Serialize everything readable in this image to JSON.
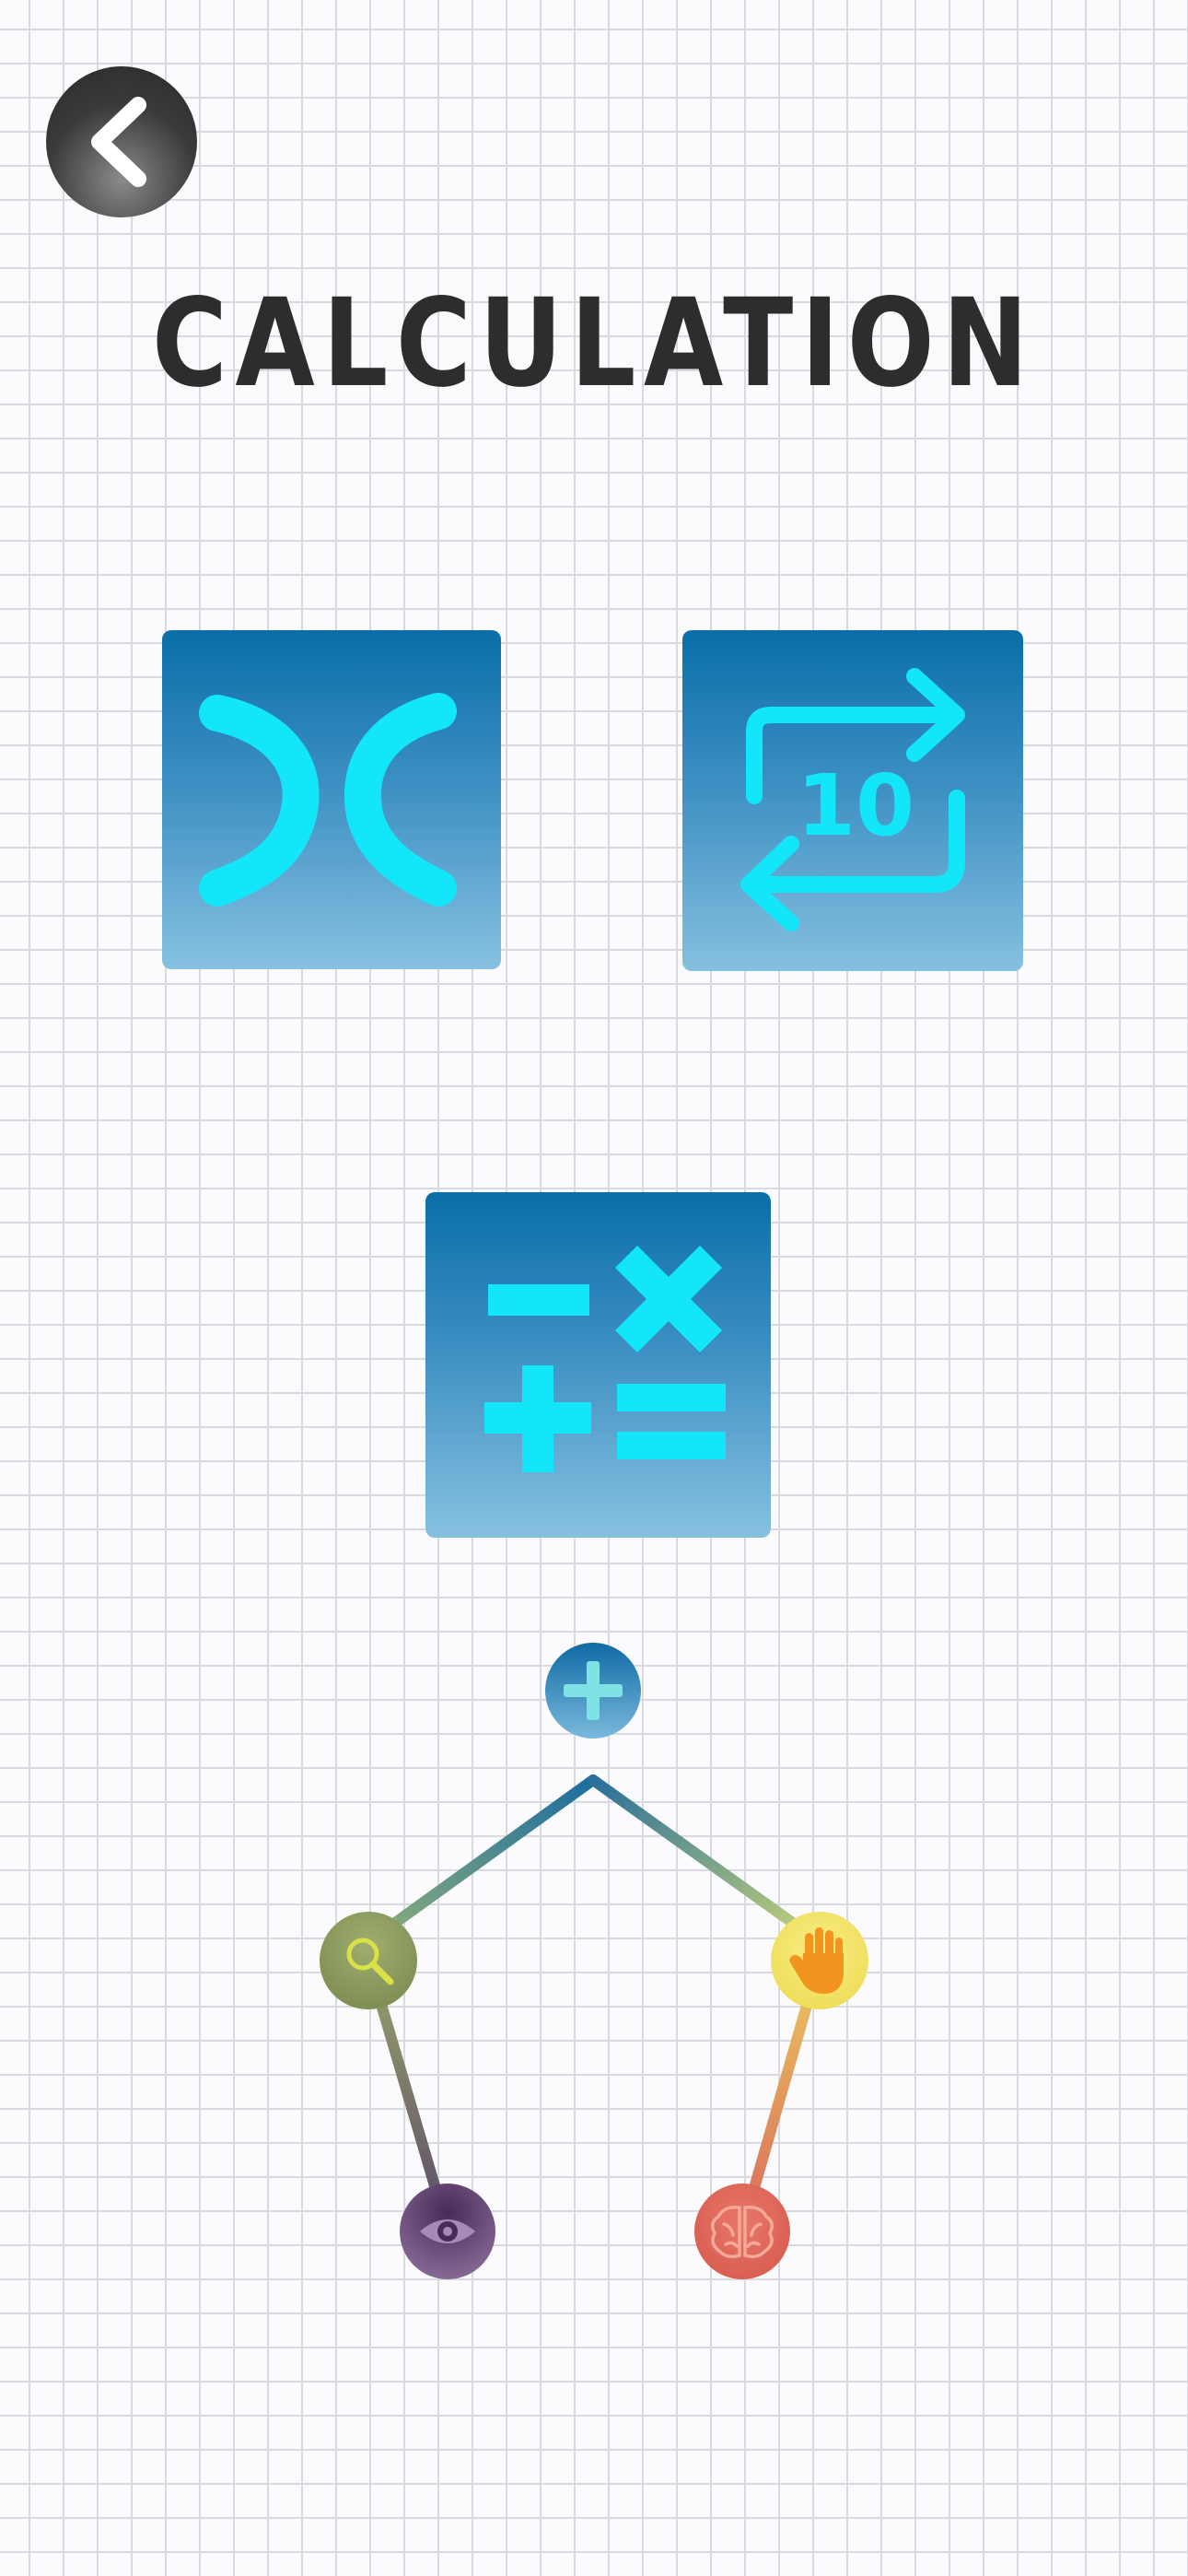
{
  "screen": {
    "title": "CALCULATION"
  },
  "header": {
    "back_icon": "chevron-left-icon"
  },
  "menu": {
    "tiles": [
      {
        "id": "compare",
        "icon": "greater-less-than-icon"
      },
      {
        "id": "number-exchange",
        "icon": "swap-arrows-10-icon",
        "number_text": "10"
      },
      {
        "id": "operations",
        "icon": "math-operators-icon"
      }
    ]
  },
  "skills_diagram": {
    "top_icon": "plus-icon",
    "nodes": [
      {
        "id": "search",
        "icon": "magnifier-icon",
        "color": "#8a9a5e"
      },
      {
        "id": "hand",
        "icon": "hand-icon",
        "color": "#f2e46a"
      },
      {
        "id": "eye",
        "icon": "eye-icon",
        "color": "#5a3e68"
      },
      {
        "id": "brain",
        "icon": "brain-icon",
        "color": "#e06a58"
      }
    ]
  },
  "colors": {
    "tile_top": "#0a6ea8",
    "tile_bottom": "#86c0e0",
    "icon_cyan": "#12e6f8",
    "title_ink": "#2d2d2d"
  }
}
